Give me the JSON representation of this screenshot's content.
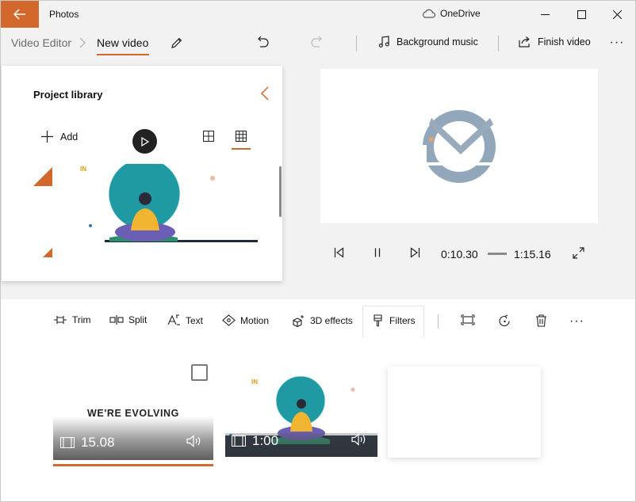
{
  "titlebar": {
    "app_title": "Photos",
    "back_icon": "arrow-left-icon",
    "onedrive_label": "OneDrive",
    "onedrive_icon": "cloud-icon",
    "accent_color": "#d2682b"
  },
  "breadcrumb": {
    "root": "Video Editor",
    "current": "New video"
  },
  "commands": {
    "background_music": "Background music",
    "finish_video": "Finish video",
    "more": "···"
  },
  "library": {
    "title": "Project library",
    "add_label": "Add",
    "collapse_icon": "chevron-left-icon",
    "view_modes": [
      "large-grid-icon",
      "small-grid-icon"
    ],
    "selected_view": "small-grid-icon",
    "thumb_badge": "IN"
  },
  "playback": {
    "current_time": "0:10.30",
    "total_time": "1:15.16",
    "state": "paused"
  },
  "tools": {
    "trim": "Trim",
    "split": "Split",
    "text": "Text",
    "motion": "Motion",
    "effects_3d": "3D effects",
    "filters": "Filters",
    "more": "···"
  },
  "storyboard": {
    "clips": [
      {
        "caption": "WE'RE EVOLVING",
        "duration": "15.08",
        "selected": true
      },
      {
        "badge": "IN",
        "duration": "1:00",
        "selected": false
      }
    ]
  }
}
